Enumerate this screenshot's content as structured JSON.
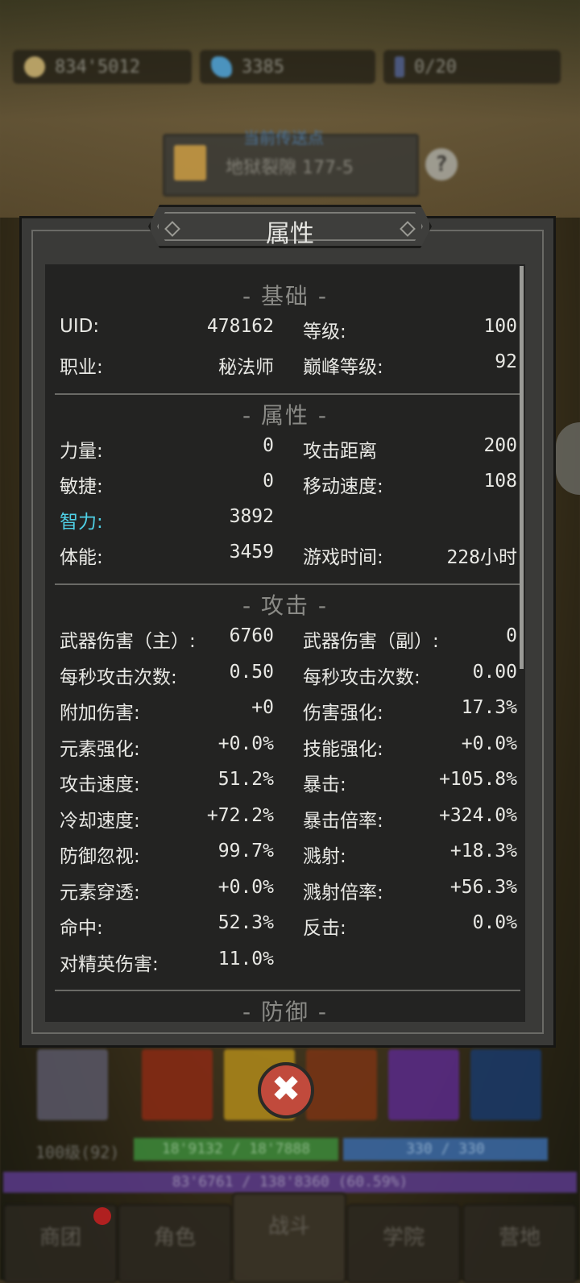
{
  "resources": {
    "gold": "834'5012",
    "gems": "3385",
    "keys": "0/20"
  },
  "portal": {
    "caption": "当前传送点",
    "location": "地狱裂隙 177-5",
    "help_label": "?"
  },
  "panel": {
    "title": "属性",
    "sections": {
      "basic": "- 基础 -",
      "attributes": "- 属性 -",
      "attack": "- 攻击 -",
      "defense": "- 防御 -"
    },
    "basic": [
      {
        "l1": "UID:",
        "v1": "478162",
        "l2": "等级:",
        "v2": "100"
      },
      {
        "l1": "职业:",
        "v1": "秘法师",
        "l2": "巅峰等级:",
        "v2": "92"
      }
    ],
    "attributes": [
      {
        "l1": "力量:",
        "v1": "0",
        "l2": "攻击距离",
        "v2": "200"
      },
      {
        "l1": "敏捷:",
        "v1": "0",
        "l2": "移动速度:",
        "v2": "108"
      },
      {
        "l1": "智力:",
        "v1": "3892",
        "l2": "",
        "v2": ""
      },
      {
        "l1": "体能:",
        "v1": "3459",
        "l2": "游戏时间:",
        "v2": "228小时"
      }
    ],
    "attack": [
      {
        "l1": "武器伤害（主）:",
        "v1": "6760",
        "l2": "武器伤害（副）:",
        "v2": "0"
      },
      {
        "l1": "每秒攻击次数:",
        "v1": "0.50",
        "l2": "每秒攻击次数:",
        "v2": "0.00"
      },
      {
        "l1": "附加伤害:",
        "v1": "+0",
        "l2": "伤害强化:",
        "v2": "17.3%"
      },
      {
        "l1": "元素强化:",
        "v1": "+0.0%",
        "l2": "技能强化:",
        "v2": "+0.0%"
      },
      {
        "l1": "攻击速度:",
        "v1": "51.2%",
        "l2": "暴击:",
        "v2": "+105.8%"
      },
      {
        "l1": "冷却速度:",
        "v1": "+72.2%",
        "l2": "暴击倍率:",
        "v2": "+324.0%"
      },
      {
        "l1": "防御忽视:",
        "v1": "99.7%",
        "l2": "溅射:",
        "v2": "+18.3%"
      },
      {
        "l1": "元素穿透:",
        "v1": "+0.0%",
        "l2": "溅射倍率:",
        "v2": "+56.3%"
      },
      {
        "l1": "命中:",
        "v1": "52.3%",
        "l2": "反击:",
        "v2": "0.0%"
      },
      {
        "l1": "对精英伤害:",
        "v1": "11.0%",
        "l2": "",
        "v2": ""
      }
    ]
  },
  "status": {
    "level": "100级(92)",
    "hp": "18'9132 / 18'7888",
    "mp": "330 / 330",
    "xp": "83'6761 / 138'8360 (60.59%)"
  },
  "nav": [
    "商团",
    "角色",
    "战斗",
    "学院",
    "营地"
  ],
  "colors": {
    "highlight_stat": "#4fd0e6",
    "panel_bg": "#232322",
    "close_button": "#c14a3c"
  }
}
